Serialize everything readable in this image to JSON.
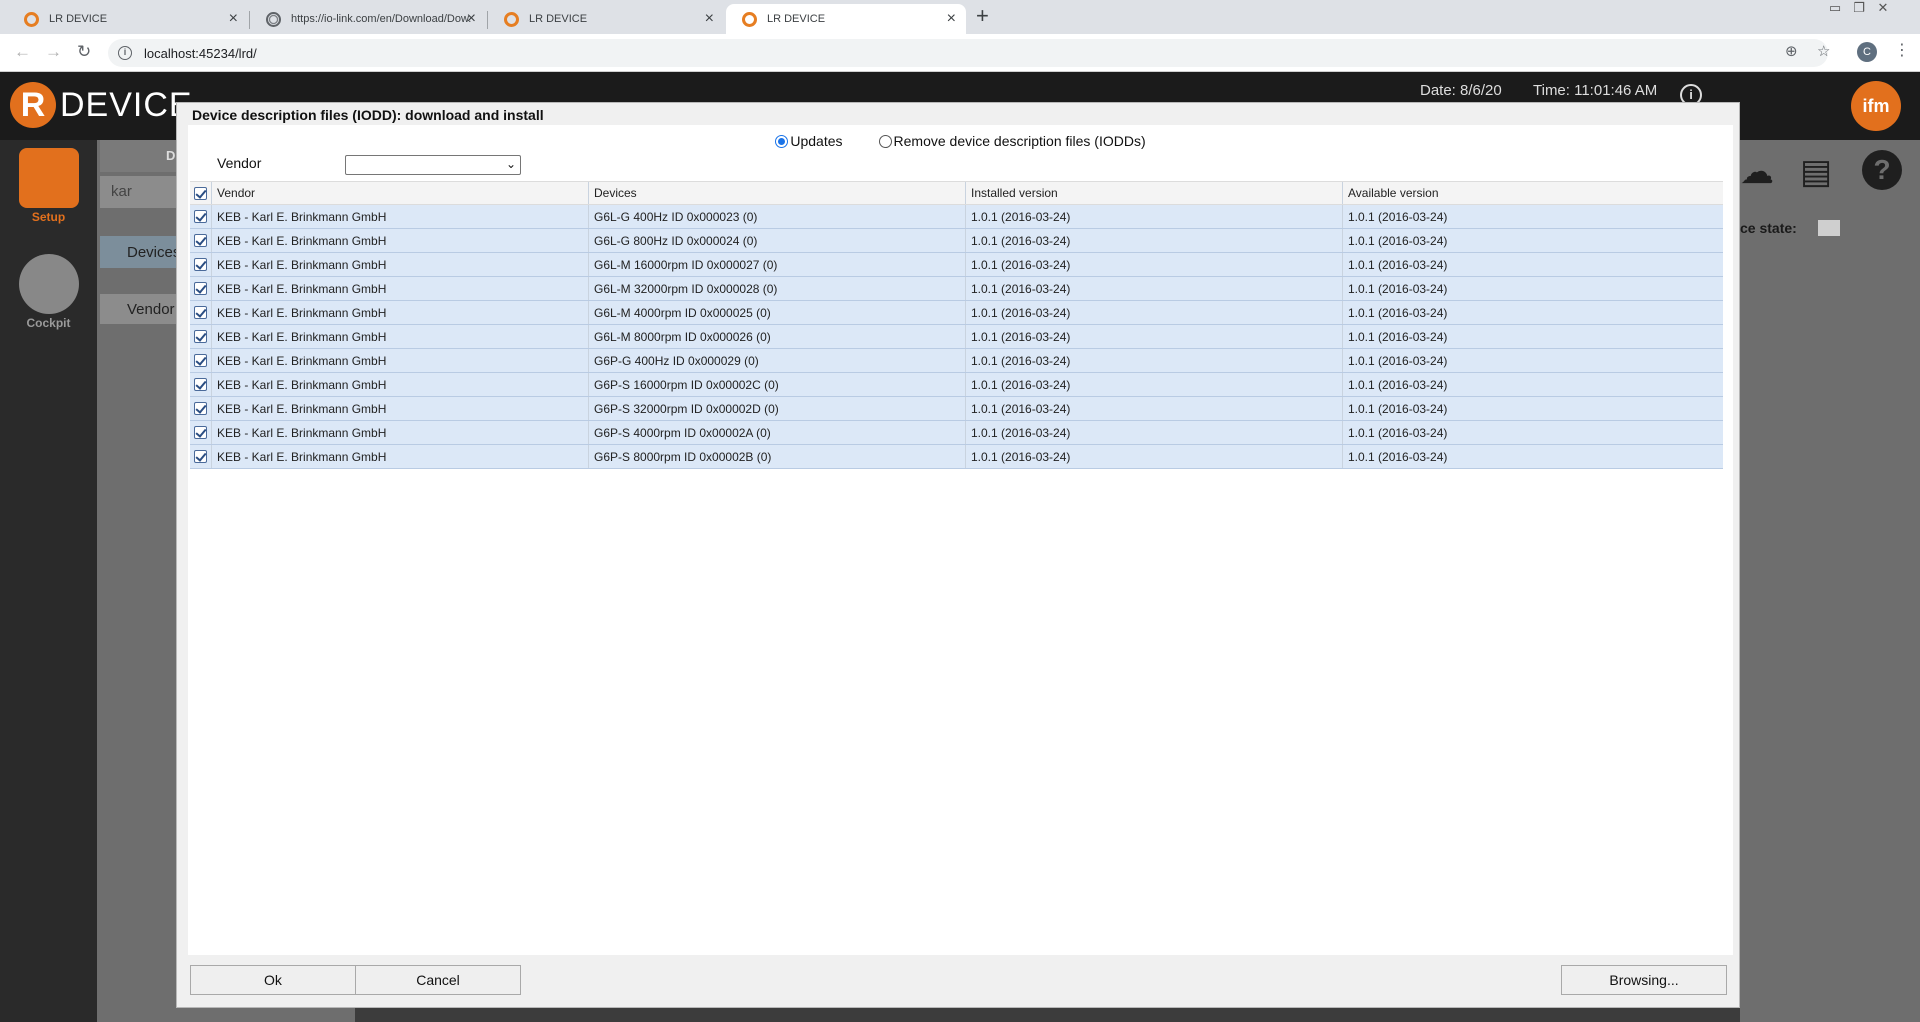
{
  "browser": {
    "tabs": [
      {
        "title": "LR DEVICE",
        "icon": "lr-device-favicon",
        "active": false
      },
      {
        "title": "https://io-link.com/en/Download/Dow...",
        "icon": "globe-icon",
        "active": false
      },
      {
        "title": "LR DEVICE",
        "icon": "lr-device-favicon",
        "active": false
      },
      {
        "title": "LR DEVICE",
        "icon": "lr-device-favicon",
        "active": true
      }
    ],
    "new_tab_symbol": "+",
    "url": "localhost:45234/lrd/",
    "profile_initial": "C"
  },
  "app": {
    "logo_letter": "R",
    "logo_text": "DEVICE",
    "date": "Date: 8/6/20",
    "time": "Time: 11:01:46 AM",
    "info_symbol": "i",
    "brand": "ifm",
    "rail": [
      {
        "label": "Setup",
        "icon": "setup-icon"
      },
      {
        "label": "Cockpit",
        "icon": "cockpit-icon"
      }
    ],
    "background": {
      "search_text": "kar",
      "devices_label": "Devices",
      "vendor_label": "Vendor",
      "col_header_partial": "D",
      "device_state_label": "ce state:"
    }
  },
  "dialog": {
    "title": "Device description files (IODD): download and install",
    "radio_updates": "Updates",
    "radio_remove": "Remove device description files (IODDs)",
    "vendor_label": "Vendor",
    "vendor_value": "",
    "columns": {
      "vendor": "Vendor",
      "devices": "Devices",
      "installed": "Installed version",
      "available": "Available version"
    },
    "rows": [
      {
        "vendor": "KEB - Karl E. Brinkmann GmbH",
        "device": "G6L-G 400Hz ID 0x000023 (0)",
        "installed": "1.0.1 (2016-03-24)",
        "available": "1.0.1 (2016-03-24)"
      },
      {
        "vendor": "KEB - Karl E. Brinkmann GmbH",
        "device": "G6L-G 800Hz ID 0x000024 (0)",
        "installed": "1.0.1 (2016-03-24)",
        "available": "1.0.1 (2016-03-24)"
      },
      {
        "vendor": "KEB - Karl E. Brinkmann GmbH",
        "device": "G6L-M 16000rpm ID 0x000027 (0)",
        "installed": "1.0.1 (2016-03-24)",
        "available": "1.0.1 (2016-03-24)"
      },
      {
        "vendor": "KEB - Karl E. Brinkmann GmbH",
        "device": "G6L-M 32000rpm ID 0x000028 (0)",
        "installed": "1.0.1 (2016-03-24)",
        "available": "1.0.1 (2016-03-24)"
      },
      {
        "vendor": "KEB - Karl E. Brinkmann GmbH",
        "device": "G6L-M 4000rpm ID 0x000025 (0)",
        "installed": "1.0.1 (2016-03-24)",
        "available": "1.0.1 (2016-03-24)"
      },
      {
        "vendor": "KEB - Karl E. Brinkmann GmbH",
        "device": "G6L-M 8000rpm ID 0x000026 (0)",
        "installed": "1.0.1 (2016-03-24)",
        "available": "1.0.1 (2016-03-24)"
      },
      {
        "vendor": "KEB - Karl E. Brinkmann GmbH",
        "device": "G6P-G 400Hz ID 0x000029 (0)",
        "installed": "1.0.1 (2016-03-24)",
        "available": "1.0.1 (2016-03-24)"
      },
      {
        "vendor": "KEB - Karl E. Brinkmann GmbH",
        "device": "G6P-S 16000rpm ID 0x00002C (0)",
        "installed": "1.0.1 (2016-03-24)",
        "available": "1.0.1 (2016-03-24)"
      },
      {
        "vendor": "KEB - Karl E. Brinkmann GmbH",
        "device": "G6P-S 32000rpm ID 0x00002D (0)",
        "installed": "1.0.1 (2016-03-24)",
        "available": "1.0.1 (2016-03-24)"
      },
      {
        "vendor": "KEB - Karl E. Brinkmann GmbH",
        "device": "G6P-S 4000rpm ID 0x00002A (0)",
        "installed": "1.0.1 (2016-03-24)",
        "available": "1.0.1 (2016-03-24)"
      },
      {
        "vendor": "KEB - Karl E. Brinkmann GmbH",
        "device": "G6P-S 8000rpm ID 0x00002B (0)",
        "installed": "1.0.1 (2016-03-24)",
        "available": "1.0.1 (2016-03-24)"
      }
    ],
    "ok_label": "Ok",
    "cancel_label": "Cancel",
    "browse_label": "Browsing..."
  },
  "colors": {
    "accent": "#e2701d",
    "row_selected": "#dce8f7",
    "header_bg": "#1b1b1b"
  }
}
